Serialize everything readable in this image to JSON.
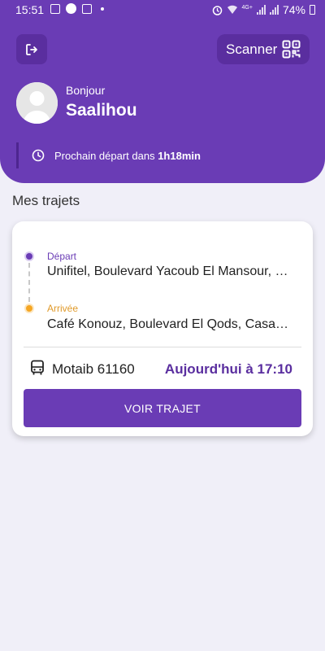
{
  "status_bar": {
    "time": "15:51",
    "network": "4G+",
    "battery": "74%"
  },
  "header": {
    "scanner_label": "Scanner",
    "greeting": "Bonjour",
    "username": "Saalihou",
    "next_departure_prefix": "Prochain départ dans ",
    "next_departure_value": "1h18min"
  },
  "section_title": "Mes trajets",
  "trip": {
    "departure_label": "Départ",
    "departure_address": "Unifitel, Boulevard Yacoub El Mansour, Casablanca",
    "arrival_label": "Arrivée",
    "arrival_address": "Café Konouz, Boulevard El Qods, Casablanca",
    "bus_name": "Motaib 61160",
    "schedule": "Aujourd'hui à 17:10",
    "view_button": "VOIR TRAJET"
  },
  "colors": {
    "primary": "#6A3CB5",
    "accent_arrival": "#F5A623",
    "background": "#F0EFF8"
  },
  "icons": [
    "logout-icon",
    "qr-code-icon",
    "avatar-icon",
    "clock-icon",
    "bus-icon"
  ]
}
